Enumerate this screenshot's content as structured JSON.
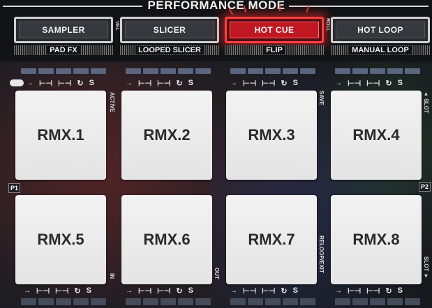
{
  "header": {
    "title": "PERFORMANCE MODE"
  },
  "modes": [
    {
      "label": "SAMPLER",
      "sub": "PAD FX",
      "side": "VEL"
    },
    {
      "label": "SLICER",
      "sub": "LOOPED SLICER",
      "side": ""
    },
    {
      "label": "HOT CUE",
      "sub": "FLIP",
      "side": "ROLL",
      "active": true
    },
    {
      "label": "HOT LOOP",
      "sub": "MANUAL LOOP",
      "side": ""
    }
  ],
  "transport": {
    "slip": "S",
    "loop": "U"
  },
  "pads": [
    "RMX.1",
    "RMX.2",
    "RMX.3",
    "RMX.4",
    "RMX.5",
    "RMX.6",
    "RMX.7",
    "RMX.8"
  ],
  "side_labels": {
    "active": "ACTIVE",
    "save": "SAVE",
    "slot_up": "▲ SLOT",
    "slot_down": "SLOT ▼",
    "in": "IN",
    "out": "OUT",
    "reloop": "RELOOP/EXIT",
    "p1": "P1",
    "p2": "P2"
  },
  "colors": {
    "active_mode": "#c01822",
    "pad": "#ececec",
    "led": "#5a6680"
  }
}
